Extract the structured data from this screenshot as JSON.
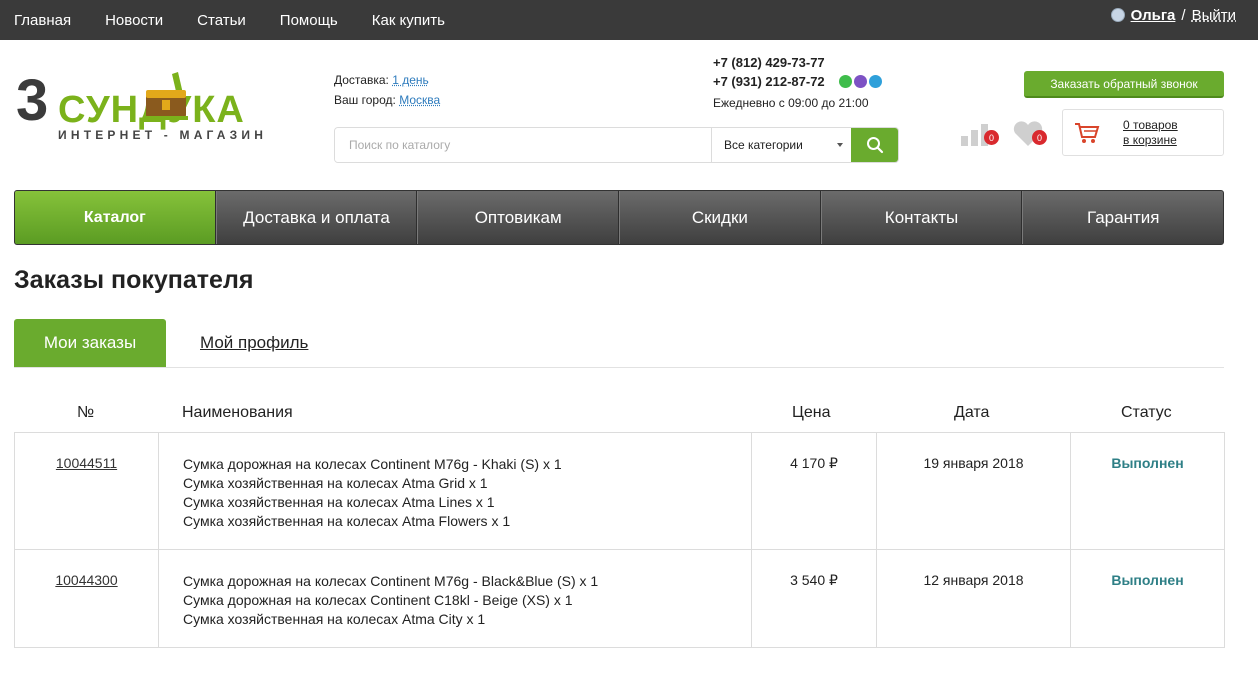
{
  "topnav": [
    "Главная",
    "Новости",
    "Статьи",
    "Помощь",
    "Как купить"
  ],
  "user": {
    "name": "Ольга",
    "separator": "/",
    "logout": "Выйти"
  },
  "logo": {
    "digit": "3",
    "word": "СУНДУКА",
    "subtitle": "ИНТЕРНЕТ - МАГАЗИН"
  },
  "delivery": {
    "label": "Доставка:",
    "value": "1 день",
    "city_label": "Ваш город:",
    "city": "Москва"
  },
  "search": {
    "placeholder": "Поиск по каталогу",
    "category": "Все категории"
  },
  "phones": {
    "phone1": "+7 (812) 429-73-77",
    "phone2": "+7 (931) 212-87-72",
    "hours": "Ежедневно с 09:00 до 21:00"
  },
  "callback_button": "Заказать обратный звонок",
  "compare_count": "0",
  "favorites_count": "0",
  "cart": {
    "line1": "0 товаров",
    "line2": "в корзине"
  },
  "mainnav": [
    "Каталог",
    "Доставка и оплата",
    "Оптовикам",
    "Скидки",
    "Контакты",
    "Гарантия"
  ],
  "page_title": "Заказы покупателя",
  "tabs": {
    "active": "Мои заказы",
    "other": "Мой профиль"
  },
  "table": {
    "headers": {
      "num": "№",
      "names": "Наименования",
      "price": "Цена",
      "date": "Дата",
      "status": "Статус"
    },
    "rows": [
      {
        "num": "10044511",
        "items": [
          "Сумка дорожная на колесах Continent M76g - Khaki (S) x 1",
          "Сумка хозяйственная на колесах Atma Grid x 1",
          "Сумка хозяйственная на колесах Atma Lines x 1",
          "Сумка хозяйственная на колесах Atma Flowers x 1"
        ],
        "price": "4 170 ₽",
        "date": "19 января 2018",
        "status": "Выполнен"
      },
      {
        "num": "10044300",
        "items": [
          "Сумка дорожная на колесах Continent M76g - Black&Blue (S) x 1",
          "Сумка дорожная на колесах Continent C18kl - Beige (XS) x 1",
          "Сумка хозяйственная на колесах Atma City x 1"
        ],
        "price": "3 540 ₽",
        "date": "12 января 2018",
        "status": "Выполнен"
      }
    ]
  },
  "colors": {
    "brand_green": "#6aab2e",
    "topbar": "#3a3a3a",
    "status": "#2e7f86",
    "badge": "#d9292e"
  }
}
